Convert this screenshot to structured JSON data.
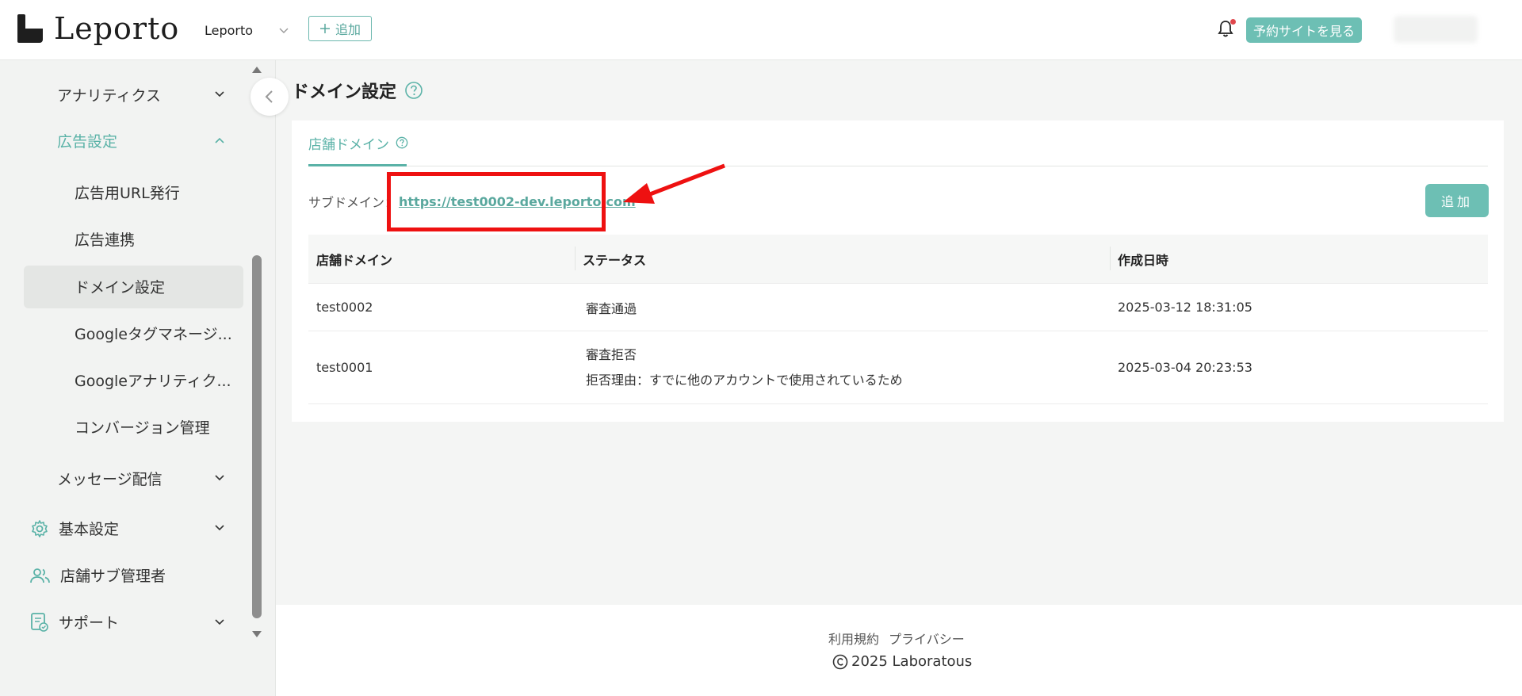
{
  "header": {
    "logo_text": "Leporto",
    "store_select": "Leporto",
    "add_label": "追加",
    "reserve_label": "予約サイトを見る"
  },
  "sidebar": {
    "items": [
      {
        "label": "アナリティクス"
      },
      {
        "label": "広告設定"
      },
      {
        "label": "広告用URL発行"
      },
      {
        "label": "広告連携"
      },
      {
        "label": "ドメイン設定"
      },
      {
        "label": "Googleタグマネージ..."
      },
      {
        "label": "Googleアナリティク..."
      },
      {
        "label": "コンバージョン管理"
      },
      {
        "label": "メッセージ配信"
      },
      {
        "label": "基本設定"
      },
      {
        "label": "店舗サブ管理者"
      },
      {
        "label": "サポート"
      }
    ]
  },
  "main": {
    "page_title": "ドメイン設定",
    "tab_label": "店舗ドメイン",
    "subdomain_label": "サブドメイン：",
    "subdomain_url": "https://test0002-dev.leporto.com",
    "add_label": "追加",
    "table": {
      "headers": [
        "店舗ドメイン",
        "ステータス",
        "作成日時"
      ],
      "rows": [
        {
          "domain": "test0002",
          "status": "審査通過",
          "reason": "",
          "created": "2025-03-12 18:31:05"
        },
        {
          "domain": "test0001",
          "status": "審査拒否",
          "reason": "拒否理由：すでに他のアカウントで使用されているため",
          "created": "2025-03-04 20:23:53"
        }
      ]
    }
  },
  "footer": {
    "terms": "利用規約",
    "privacy": "プライバシー",
    "copyright": "2025 Laboratous"
  },
  "colors": {
    "accent": "#5ab2a7",
    "button": "#6dbfb4",
    "highlight": "#ee1111"
  }
}
